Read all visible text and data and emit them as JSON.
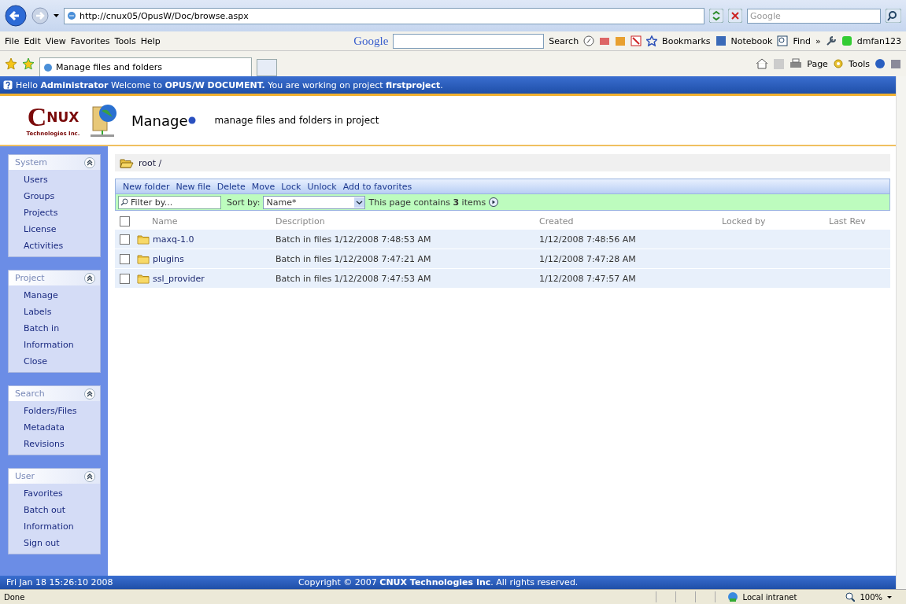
{
  "browser": {
    "address": "http://cnux05/OpusW/Doc/browse.aspx",
    "search_placeholder": "Google",
    "menu": [
      "File",
      "Edit",
      "View",
      "Favorites",
      "Tools",
      "Help"
    ],
    "toolbar": {
      "brand": "Google",
      "search_button": "Search",
      "bookmarks": "Bookmarks",
      "notebook": "Notebook",
      "find": "Find",
      "more": "»",
      "user": "dmfan123"
    },
    "tab": "Manage files and folders",
    "commands": {
      "page": "Page",
      "tools": "Tools"
    }
  },
  "welcome": "Hello **Administrator** Welcome to **OPUS/W DOCUMENT.** You are working on project **firstproject**.",
  "header": {
    "logo_mark": "C",
    "logo_name": "NUX",
    "logo_subtitle": "Technologies Inc.",
    "title": "Manage",
    "description": "manage files and folders in project"
  },
  "sidebar": [
    {
      "title": "System",
      "expanded": true,
      "items": [
        "Users",
        "Groups",
        "Projects",
        "License",
        "Activities"
      ]
    },
    {
      "title": "Project",
      "expanded": true,
      "items": [
        "Manage",
        "Labels",
        "Batch in",
        "Information",
        "Close"
      ]
    },
    {
      "title": "Search",
      "expanded": true,
      "items": [
        "Folders/Files",
        "Metadata",
        "Revisions"
      ]
    },
    {
      "title": "User",
      "expanded": true,
      "items": [
        "Favorites",
        "Batch out",
        "Information",
        "Sign out"
      ]
    }
  ],
  "breadcrumb": "root /",
  "actions": [
    "New folder",
    "New file",
    "Delete",
    "Move",
    "Lock",
    "Unlock",
    "Add to favorites"
  ],
  "filter": {
    "placeholder": "Filter by...",
    "sort_label": "Sort by:",
    "sort_value": "Name*",
    "item_count": "This page contains **3** items"
  },
  "table": {
    "select_all_checked": false,
    "columns": [
      "Name",
      "Description",
      "Created",
      "Locked by",
      "Last Rev"
    ],
    "rows": [
      {
        "checked": false,
        "name": "maxq-1.0",
        "description": "Batch in files 1/12/2008 7:48:53 AM",
        "created": "1/12/2008 7:48:56 AM"
      },
      {
        "checked": false,
        "name": "plugins",
        "description": "Batch in files 1/12/2008 7:47:21 AM",
        "created": "1/12/2008 7:47:28 AM"
      },
      {
        "checked": false,
        "name": "ssl_provider",
        "description": "Batch in files 1/12/2008 7:47:53 AM",
        "created": "1/12/2008 7:47:57 AM"
      }
    ]
  },
  "footer": {
    "date": "Fri Jan 18 15:26:10 2008",
    "copyright": "Copyright © 2007 **CNUX Technologies Inc**. All rights reserved."
  },
  "status": {
    "text": "Done",
    "zone": "Local intranet",
    "zoom": "100%"
  }
}
